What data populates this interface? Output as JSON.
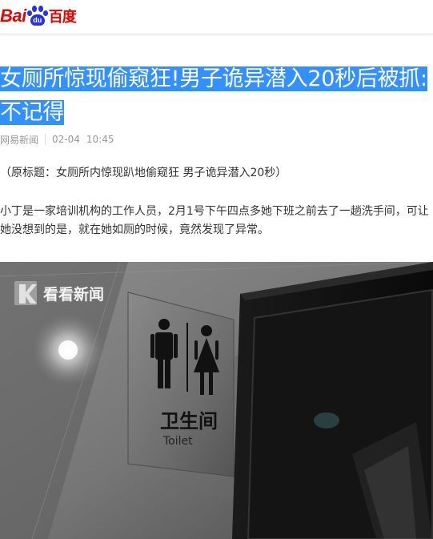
{
  "header": {
    "logo_text_left": "Bai",
    "logo_paw_text": "du",
    "logo_text_right": "百度"
  },
  "article": {
    "title": "女厕所惊现偷窥狂!男子诡异潜入20秒后被抓:不记得",
    "source": "网易新闻",
    "date": "02-04",
    "time": "10:45",
    "paragraphs": [
      "（原标题：女厕所内惊现趴地偷窥狂 男子诡异潜入20秒）",
      "小丁是一家培训机构的工作人员，2月1号下午四点多她下班之前去了一趟洗手间，可让她没想到的是，就在她如厕的时候，竟然发现了异常。"
    ]
  },
  "image": {
    "watermark": "看看新闻",
    "sign_text_cn": "卫生间",
    "sign_text_en": "Toilet"
  },
  "colors": {
    "brand_red": "#e10601",
    "brand_blue": "#2932e1",
    "title_highlight": "#3390ff"
  }
}
